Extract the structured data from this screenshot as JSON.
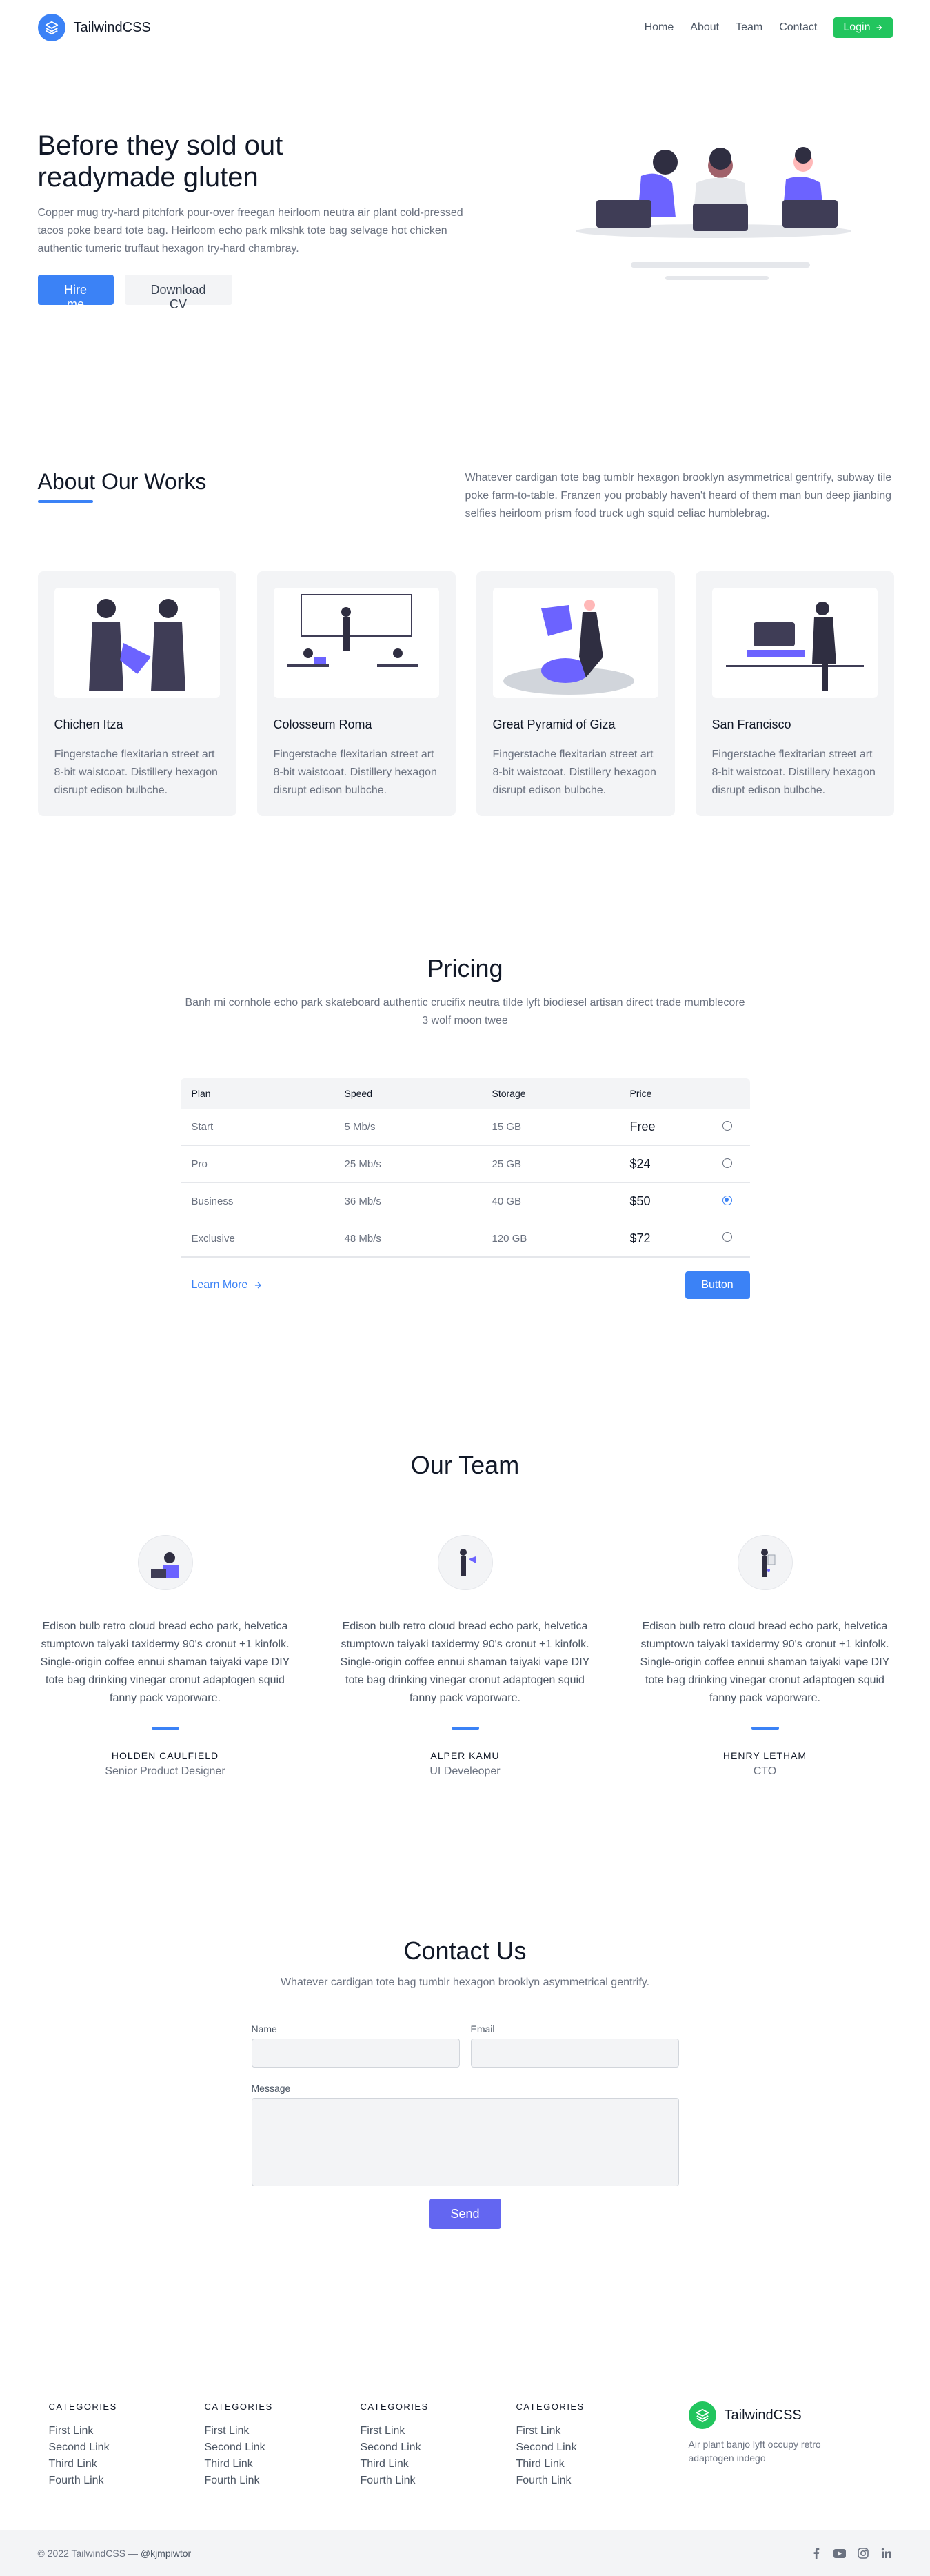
{
  "header": {
    "brand": "TailwindCSS",
    "nav": [
      "Home",
      "About",
      "Team",
      "Contact"
    ],
    "login_label": "Login"
  },
  "hero": {
    "title_line1": "Before they sold out",
    "title_line2": "readymade gluten",
    "description": "Copper mug try-hard pitchfork pour-over freegan heirloom neutra air plant cold-pressed tacos poke beard tote bag. Heirloom echo park mlkshk tote bag selvage hot chicken authentic tumeric truffaut hexagon try-hard chambray.",
    "primary_button": "Hire me",
    "secondary_button": "Download CV"
  },
  "about": {
    "title": "About Our Works",
    "description": "Whatever cardigan tote bag tumblr hexagon brooklyn asymmetrical gentrify, subway tile poke farm-to-table. Franzen you probably haven't heard of them man bun deep jianbing selfies heirloom prism food truck ugh squid celiac humblebrag.",
    "cards": [
      {
        "title": "Chichen Itza",
        "desc": "Fingerstache flexitarian street art 8-bit waistcoat. Distillery hexagon disrupt edison bulbche."
      },
      {
        "title": "Colosseum Roma",
        "desc": "Fingerstache flexitarian street art 8-bit waistcoat. Distillery hexagon disrupt edison bulbche."
      },
      {
        "title": "Great Pyramid of Giza",
        "desc": "Fingerstache flexitarian street art 8-bit waistcoat. Distillery hexagon disrupt edison bulbche."
      },
      {
        "title": "San Francisco",
        "desc": "Fingerstache flexitarian street art 8-bit waistcoat. Distillery hexagon disrupt edison bulbche."
      }
    ]
  },
  "pricing": {
    "title": "Pricing",
    "description": "Banh mi cornhole echo park skateboard authentic crucifix neutra tilde lyft biodiesel artisan direct trade mumblecore 3 wolf moon twee",
    "headers": [
      "Plan",
      "Speed",
      "Storage",
      "Price"
    ],
    "rows": [
      {
        "plan": "Start",
        "speed": "5 Mb/s",
        "storage": "15 GB",
        "price": "Free",
        "selected": false
      },
      {
        "plan": "Pro",
        "speed": "25 Mb/s",
        "storage": "25 GB",
        "price": "$24",
        "selected": false
      },
      {
        "plan": "Business",
        "speed": "36 Mb/s",
        "storage": "40 GB",
        "price": "$50",
        "selected": true
      },
      {
        "plan": "Exclusive",
        "speed": "48 Mb/s",
        "storage": "120 GB",
        "price": "$72",
        "selected": false
      }
    ],
    "learn_more": "Learn More",
    "button": "Button"
  },
  "team": {
    "title": "Our Team",
    "members": [
      {
        "bio": "Edison bulb retro cloud bread echo park, helvetica stumptown taiyaki taxidermy 90's cronut +1 kinfolk. Single-origin coffee ennui shaman taiyaki vape DIY tote bag drinking vinegar cronut adaptogen squid fanny pack vaporware.",
        "name": "HOLDEN CAULFIELD",
        "role": "Senior Product Designer"
      },
      {
        "bio": "Edison bulb retro cloud bread echo park, helvetica stumptown taiyaki taxidermy 90's cronut +1 kinfolk. Single-origin coffee ennui shaman taiyaki vape DIY tote bag drinking vinegar cronut adaptogen squid fanny pack vaporware.",
        "name": "ALPER KAMU",
        "role": "UI Develeoper"
      },
      {
        "bio": "Edison bulb retro cloud bread echo park, helvetica stumptown taiyaki taxidermy 90's cronut +1 kinfolk. Single-origin coffee ennui shaman taiyaki vape DIY tote bag drinking vinegar cronut adaptogen squid fanny pack vaporware.",
        "name": "HENRY LETHAM",
        "role": "CTO"
      }
    ]
  },
  "contact": {
    "title": "Contact Us",
    "description": "Whatever cardigan tote bag tumblr hexagon brooklyn asymmetrical gentrify.",
    "name_label": "Name",
    "email_label": "Email",
    "message_label": "Message",
    "send_label": "Send"
  },
  "footer": {
    "columns": [
      {
        "category": "CATEGORIES",
        "links": [
          "First Link",
          "Second Link",
          "Third Link",
          "Fourth Link"
        ]
      },
      {
        "category": "CATEGORIES",
        "links": [
          "First Link",
          "Second Link",
          "Third Link",
          "Fourth Link"
        ]
      },
      {
        "category": "CATEGORIES",
        "links": [
          "First Link",
          "Second Link",
          "Third Link",
          "Fourth Link"
        ]
      },
      {
        "category": "CATEGORIES",
        "links": [
          "First Link",
          "Second Link",
          "Third Link",
          "Fourth Link"
        ]
      }
    ],
    "brand": "TailwindCSS",
    "brand_desc": "Air plant banjo lyft occupy retro adaptogen indego",
    "copyright": "© 2022 TailwindCSS —",
    "handle": "@kjmpiwtor",
    "socials": [
      "facebook-icon",
      "youtube-icon",
      "instagram-icon",
      "linkedin-icon"
    ]
  },
  "colors": {
    "primary": "#3b82f6",
    "login": "#22c55e",
    "send": "#6366f1",
    "illustration_accent": "#6c63ff"
  }
}
